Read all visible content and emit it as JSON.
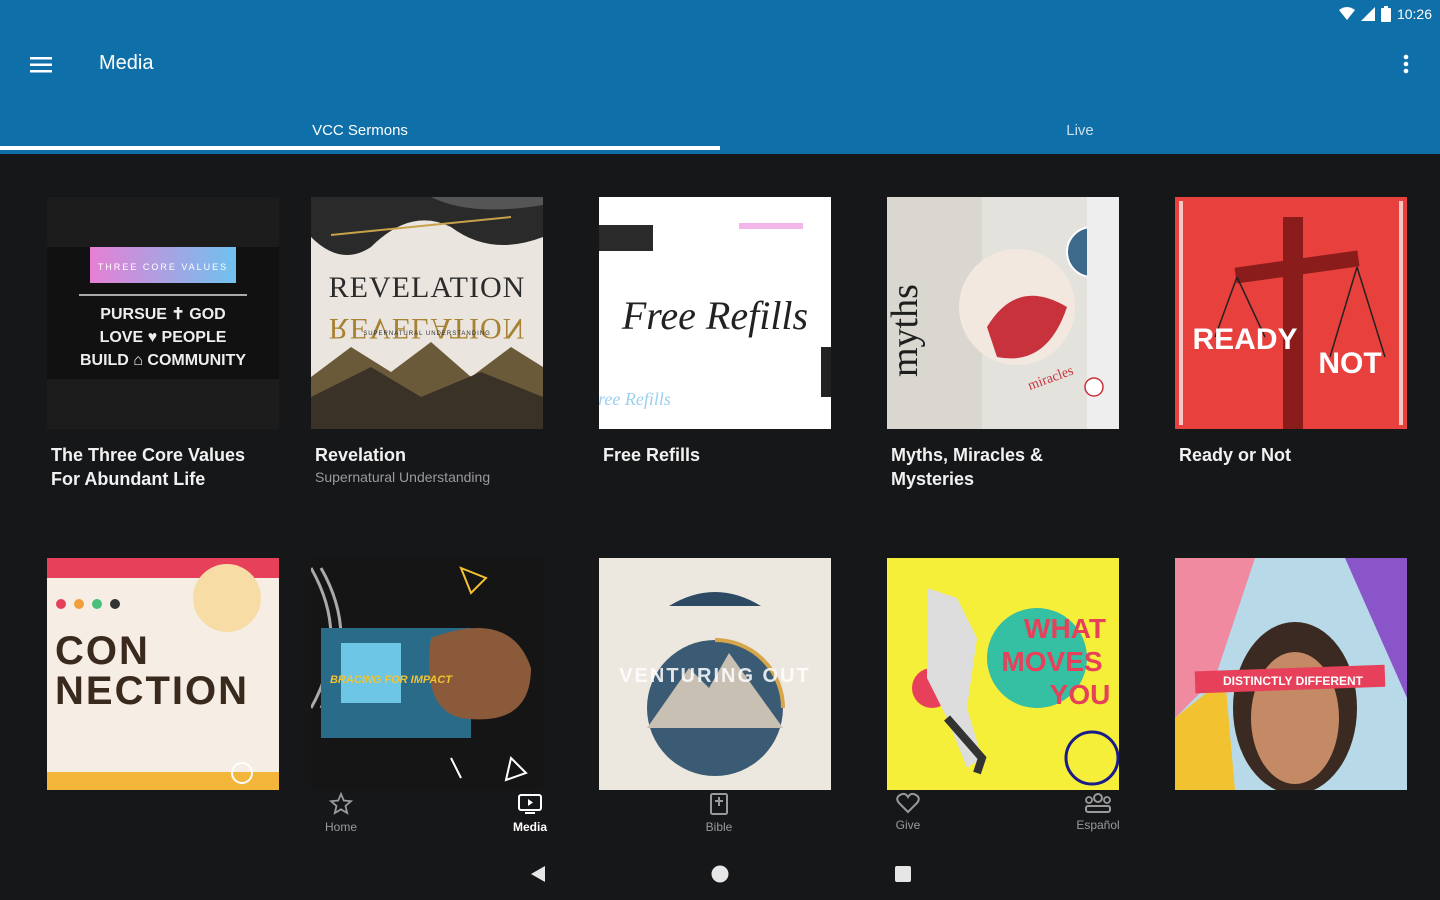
{
  "status": {
    "time": "10:26"
  },
  "appbar": {
    "title": "Media"
  },
  "tabs": [
    {
      "label": "VCC Sermons",
      "active": true
    },
    {
      "label": "Live",
      "active": false
    }
  ],
  "grid": {
    "items": [
      {
        "title": "The Three Core Values For Abundant Life",
        "subtitle": "",
        "art": {
          "caption": "THREE CORE VALUES",
          "lines": [
            "PURSUE ✝ GOD",
            "LOVE ♥ PEOPLE",
            "BUILD ⌂ COMMUNITY"
          ]
        }
      },
      {
        "title": "Revelation",
        "subtitle": "Supernatural Understanding",
        "art": {
          "word": "REVELATION",
          "caption": "SUPERNATURAL UNDERSTANDING"
        }
      },
      {
        "title": "Free Refills",
        "subtitle": "",
        "art": {
          "word": "Free Refills"
        }
      },
      {
        "title": "Myths, Miracles & Mysteries",
        "subtitle": "",
        "art": {
          "word": "myths",
          "small": "miracles"
        }
      },
      {
        "title": "Ready or Not",
        "subtitle": "",
        "art": {
          "left": "READY",
          "right": "NOT"
        }
      },
      {
        "title": "",
        "subtitle": "",
        "art": {
          "line1": "CON",
          "line2": "NECTION"
        }
      },
      {
        "title": "",
        "subtitle": "",
        "art": {
          "caption": "BRACING FOR IMPACT"
        }
      },
      {
        "title": "",
        "subtitle": "",
        "art": {
          "word": "VENTURING OUT"
        }
      },
      {
        "title": "",
        "subtitle": "",
        "art": {
          "lines": [
            "WHAT",
            "MOVES",
            "YOU"
          ]
        }
      },
      {
        "title": "",
        "subtitle": "",
        "art": {
          "caption": "DISTINCTLY DIFFERENT"
        }
      }
    ]
  },
  "bottomnav": {
    "items": [
      {
        "label": "Home",
        "icon": "star-icon",
        "active": false
      },
      {
        "label": "Media",
        "icon": "tv-icon",
        "active": true
      },
      {
        "label": "Bible",
        "icon": "book-icon",
        "active": false
      },
      {
        "label": "Give",
        "icon": "heart-icon",
        "active": false
      },
      {
        "label": "Español",
        "icon": "group-icon",
        "active": false
      }
    ]
  },
  "colors": {
    "appbar": "#0f6fa8",
    "background": "#161719",
    "accent_red": "#e8403c"
  }
}
